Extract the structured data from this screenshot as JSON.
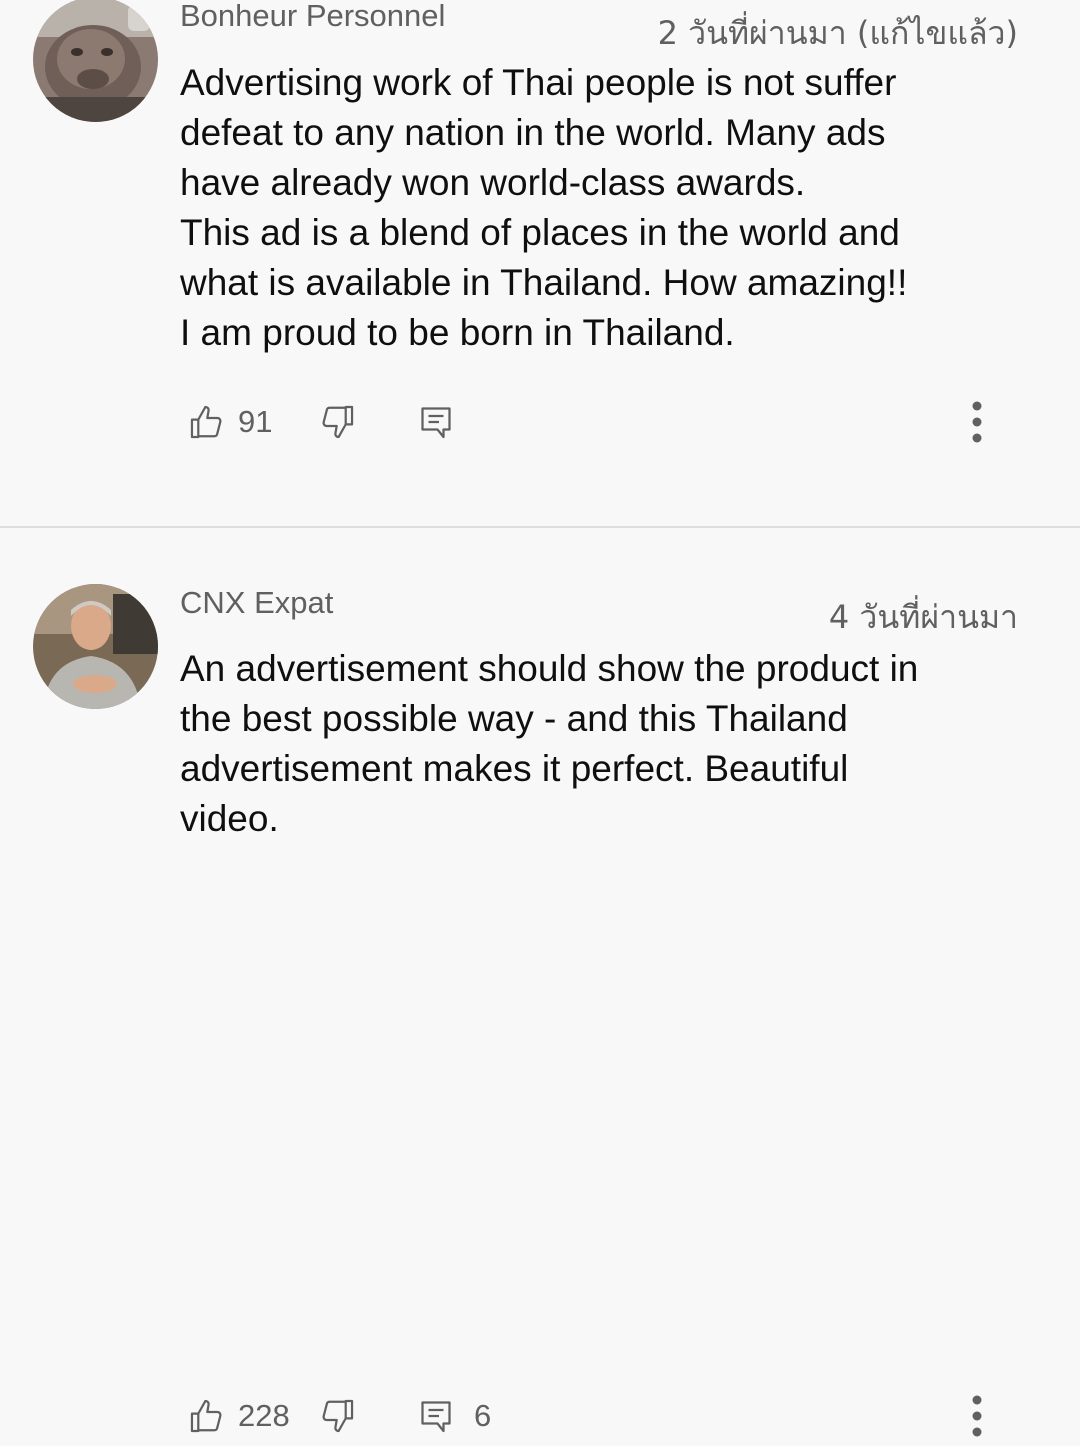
{
  "comments": [
    {
      "author": "Bonheur Personnel",
      "time": "2 วันที่ผ่านมา (แก้ไขแล้ว)",
      "text": "Advertising work of Thai people is not suffer\ndefeat to any nation in the world.  Many ads\nhave already won world-class awards.\nThis ad is a blend of places in the world and\nwhat is available in Thailand.  How amazing!!\nI am proud to be born in Thailand.",
      "likes": "91",
      "replies": ""
    },
    {
      "author": "CNX Expat",
      "time": "4 วันที่ผ่านมา",
      "text": "An advertisement should show the product in\nthe best possible way - and this Thailand\nadvertisement makes it perfect. Beautiful\nvideo.",
      "likes": "228",
      "replies": "6"
    }
  ],
  "icons": {
    "like": "thumbs-up-icon",
    "dislike": "thumbs-down-icon",
    "reply": "reply-comment-icon",
    "more": "more-vertical-icon"
  },
  "colors": {
    "background": "#f8f8f8",
    "secondary_text": "#606060",
    "primary_text": "#0f0f0f",
    "divider": "#dedede"
  }
}
